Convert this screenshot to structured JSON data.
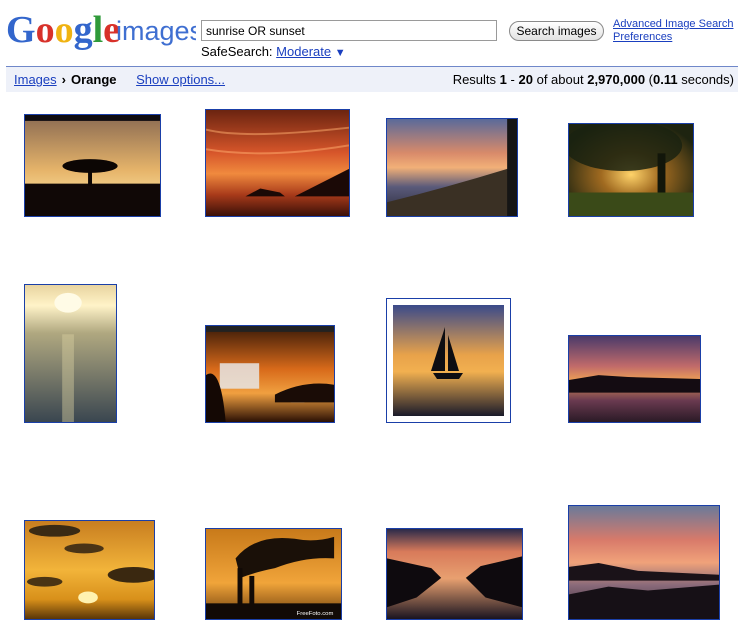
{
  "header": {
    "logo_text": "Google images",
    "search_value": "sunrise OR sunset",
    "search_button": "Search images",
    "advanced_link": "Advanced Image Search",
    "preferences_link": "Preferences",
    "safesearch_label": "SafeSearch:",
    "safesearch_value": "Moderate",
    "safesearch_arrow": "▼"
  },
  "bar": {
    "breadcrumb_root": "Images",
    "separator": "›",
    "breadcrumb_current": "Orange",
    "show_options": "Show options...",
    "results_prefix": "Results",
    "results_from": "1",
    "results_dash": "-",
    "results_to": "20",
    "results_of": "of about",
    "results_total": "2,970,000",
    "results_time": "0.11",
    "results_seconds": "seconds"
  },
  "colors": {
    "link": "#1a3fbf",
    "bar_bg": "#eef1f9",
    "bar_border": "#6f87c9",
    "thumb_border": "#1a3fa8"
  },
  "results": [
    {
      "subject": "acacia-tree-silhouette"
    },
    {
      "subject": "red-sky-over-sea"
    },
    {
      "subject": "coastline-sunset"
    },
    {
      "subject": "sun-through-tree"
    },
    {
      "subject": "sun-over-ocean"
    },
    {
      "subject": "desktop-screenshot"
    },
    {
      "subject": "sailboat-sunset"
    },
    {
      "subject": "purple-lake-sunset"
    },
    {
      "subject": "cloudy-golden-sunset"
    },
    {
      "subject": "smokestacks-sunset",
      "watermark": "FreeFoto.com"
    },
    {
      "subject": "river-sunset"
    },
    {
      "subject": "pink-sky-harbor"
    }
  ]
}
